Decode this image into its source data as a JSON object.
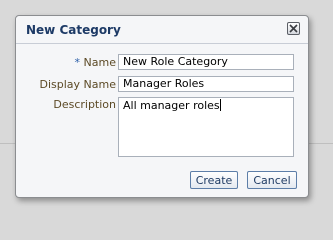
{
  "dialog": {
    "title": "New Category",
    "close_icon": "close-x-icon"
  },
  "form": {
    "required_marker": "*",
    "name_label": "Name",
    "name_value": "New Role Category",
    "display_name_label": "Display Name",
    "display_name_value": "Manager Roles",
    "description_label": "Description",
    "description_value": "All manager roles"
  },
  "buttons": {
    "create": "Create",
    "cancel": "Cancel"
  },
  "colors": {
    "title": "#1d3a66",
    "label": "#5c4a26",
    "required": "#2b5ea8",
    "button_border": "#5d7ea8"
  }
}
